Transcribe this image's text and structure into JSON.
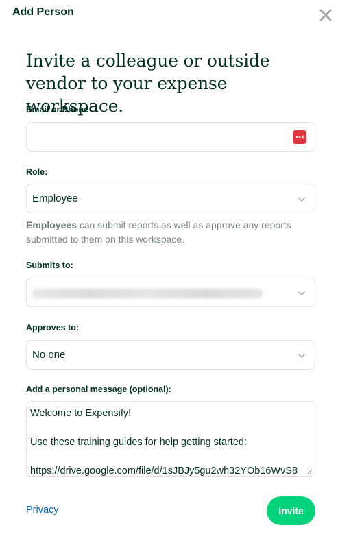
{
  "header": {
    "title": "Add Person",
    "close_icon": "close-icon"
  },
  "headline": "Invite a colleague or outside vendor to your expense workspace.",
  "email": {
    "label": "Email or Phone",
    "value": "",
    "icon": "password-manager-icon"
  },
  "role": {
    "label": "Role:",
    "value": "Employee",
    "help_bold": "Employees",
    "help_rest": " can submit reports as well as approve any reports submitted to them on this workspace."
  },
  "submits_to": {
    "label": "Submits to:",
    "value": ""
  },
  "approves_to": {
    "label": "Approves to:",
    "value": "No one"
  },
  "message": {
    "label": "Add a personal message (optional):",
    "value": "Welcome to Expensify!\n\nUse these training guides for help getting started:\n\nhttps://drive.google.com/file/d/1sJBJy5gu2wh32YOb16WvS8"
  },
  "footer": {
    "privacy_label": "Privacy",
    "invite_label": "Invite"
  },
  "colors": {
    "brand_green": "#03d47c",
    "heading": "#002e22",
    "link": "#0164bf",
    "border": "#e6e1da",
    "icon_red": "#e0373f"
  }
}
